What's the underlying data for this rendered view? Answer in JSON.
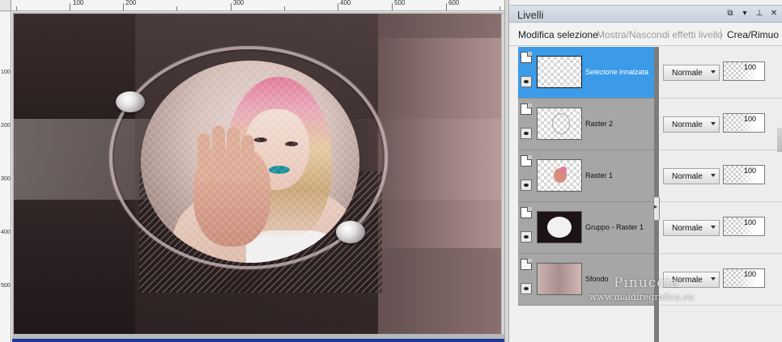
{
  "ruler": {
    "top_labels": [
      "100",
      "200",
      "300",
      "400",
      "500",
      "600"
    ],
    "left_labels": [
      "100",
      "200",
      "300",
      "400",
      "500"
    ]
  },
  "layers_panel": {
    "title": "Livelli",
    "controls": [
      "dock-icon",
      "menu-arrow-icon",
      "pin-icon",
      "close-icon"
    ],
    "toolbar": {
      "edit_selection": "Modifica selezione",
      "toggle_effects": "Mostra/Nascondi effetti livello",
      "create_remove": "Crea/Rimuo"
    },
    "layers": [
      {
        "name": "Selezione innalzata",
        "selected": true,
        "blend": "Normale",
        "opacity": "100"
      },
      {
        "name": "Raster 2",
        "selected": false,
        "blend": "Normale",
        "opacity": "100"
      },
      {
        "name": "Raster 1",
        "selected": false,
        "blend": "Normale",
        "opacity": "100"
      },
      {
        "name": "Gruppo - Raster 1",
        "selected": false,
        "blend": "Normale",
        "opacity": "100"
      },
      {
        "name": "Sfondo",
        "selected": false,
        "blend": "Normale",
        "opacity": "100"
      }
    ]
  },
  "watermark": {
    "name": "Pinuccia",
    "url": "www.maidiregrafica.eu"
  },
  "colors": {
    "selection": "#3b9be8",
    "panel_title_bg": "#c9d1dc",
    "canvas_bottom_bar": "#1e3a9e"
  }
}
